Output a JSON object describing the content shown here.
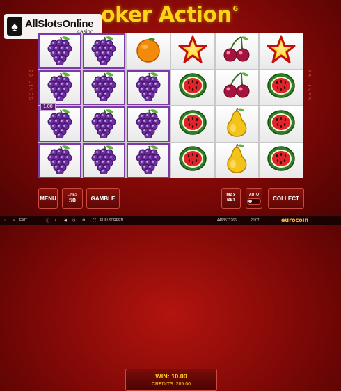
{
  "watermark": {
    "main": "AllSlotsOnline",
    "sub": ".casino"
  },
  "game": {
    "title": "oker Action",
    "title_sup": "6"
  },
  "side_labels": {
    "left": "28 LINES",
    "right": "28 LINES"
  },
  "reels": [
    [
      "grapes",
      "grapes",
      "grapes",
      "grapes"
    ],
    [
      "grapes",
      "grapes",
      "grapes",
      "grapes"
    ],
    [
      "orange",
      "grapes",
      "grapes",
      "grapes"
    ],
    [
      "star",
      "watermelon",
      "watermelon",
      "watermelon"
    ],
    [
      "cherries",
      "cherries",
      "pear",
      "pear"
    ],
    [
      "star",
      "watermelon",
      "watermelon",
      "watermelon"
    ]
  ],
  "line_win_label": "1.00",
  "controls": {
    "menu": "MENU",
    "lines_label": "LINES",
    "lines_value": "50",
    "gamble": "GAMBLE",
    "win": "WIN: 10.00",
    "credits": "CREDITS: 285.00",
    "max_bet": "MAX BET",
    "auto": "AUTO",
    "collect": "COLLECT"
  },
  "status": {
    "exit": "EXIT",
    "fullscreen": "FULLSCREEN",
    "session_id": "4463571266",
    "time": "20:07",
    "brand": "eurocoin"
  },
  "colors": {
    "accent": "#ffd21a",
    "background": "#8a0c08",
    "win_outline": "#7c3aa8"
  }
}
